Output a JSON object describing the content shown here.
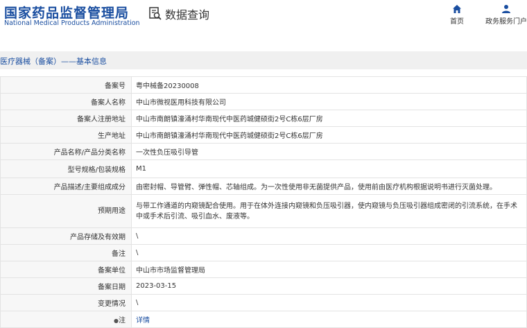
{
  "header": {
    "logo_cn": "国家药品监督管理局",
    "logo_en": "National Medical Products Administration",
    "search_title": "数据查询",
    "nav_home": "首页",
    "nav_gov": "政务服务门户"
  },
  "section_title": "医疗器械（备案）——基本信息",
  "rows": [
    {
      "label": "备案号",
      "value": "粤中械备20230008"
    },
    {
      "label": "备案人名称",
      "value": "中山市微视医用科技有限公司"
    },
    {
      "label": "备案人注册地址",
      "value": "中山市南朗镇濠涌村华南现代中医药城健硕街2号C栋6层厂房"
    },
    {
      "label": "生产地址",
      "value": "中山市南朗镇濠涌村华南现代中医药城健硕街2号C栋6层厂房"
    },
    {
      "label": "产品名称/产品分类名称",
      "value": "一次性负压吸引导管"
    },
    {
      "label": "型号规格/包装规格",
      "value": "M1"
    },
    {
      "label": "产品描述/主要组成成分",
      "value": "由密封帽、导管臂、弹性帽、芯轴组成。为一次性使用非无菌提供产品，使用前由医疗机构根据说明书进行灭菌处理。"
    },
    {
      "label": "预期用途",
      "value": "与带工作通道的内窥镜配合使用。用于在体外连接内窥镜和负压吸引器，使内窥镜与负压吸引器组成密闭的引流系统，在手术中或手术后引流、吸引血水、废液等。"
    },
    {
      "label": "产品存储及有效期",
      "value": "\\"
    },
    {
      "label": "备注",
      "value": "\\"
    },
    {
      "label": "备案单位",
      "value": "中山市市场监督管理局"
    },
    {
      "label": "备案日期",
      "value": "2023-03-15"
    },
    {
      "label": "变更情况",
      "value": "\\"
    },
    {
      "label": "注",
      "value": "详情"
    }
  ],
  "colors": {
    "brand": "#1a4ea0",
    "label_bg": "#f7f7f7",
    "section_bg": "#f0f0f0"
  }
}
